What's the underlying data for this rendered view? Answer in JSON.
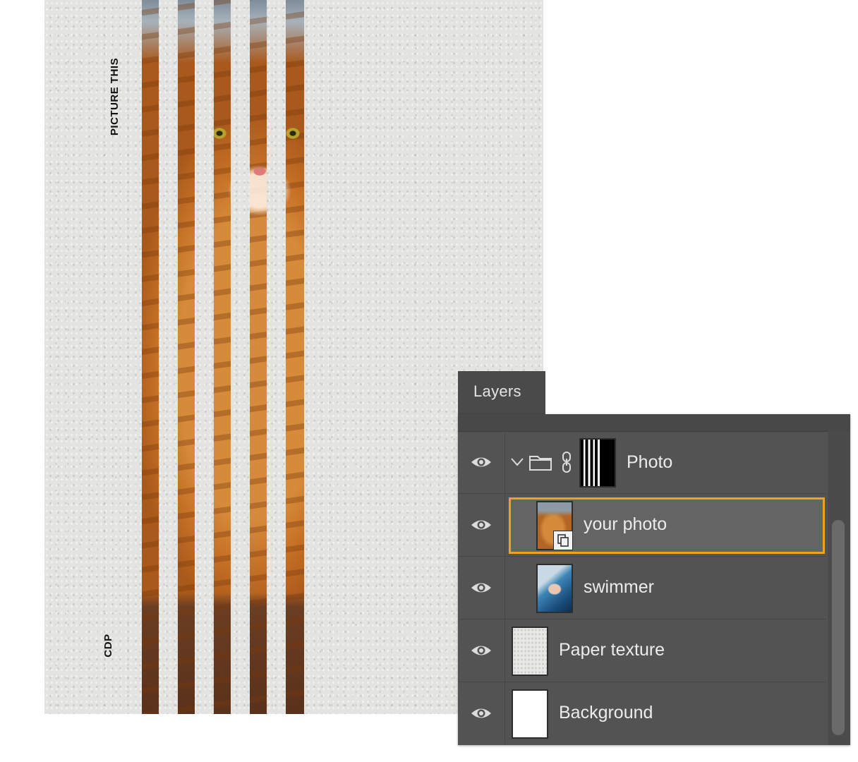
{
  "poster": {
    "title": "PICTURE THIS",
    "footer": "CDP"
  },
  "layers_panel": {
    "tab_label": "Layers",
    "selected_layer": "your photo",
    "accent_color": "#f0a21f",
    "layers": [
      {
        "name": "Photo",
        "type": "group",
        "expanded": true,
        "has_mask": true,
        "visible": true
      },
      {
        "name": "your photo",
        "type": "smart-object",
        "selected": true,
        "visible": true
      },
      {
        "name": "swimmer",
        "type": "image",
        "visible": true
      },
      {
        "name": "Paper texture",
        "type": "image",
        "visible": true
      },
      {
        "name": "Background",
        "type": "image",
        "visible": true
      }
    ]
  },
  "icons": {
    "visibility": "eye-icon",
    "group_toggle": "chevron-down-icon",
    "group": "folder-icon",
    "mask_link": "chain-link-icon",
    "smart_object": "smart-object-badge-icon"
  }
}
